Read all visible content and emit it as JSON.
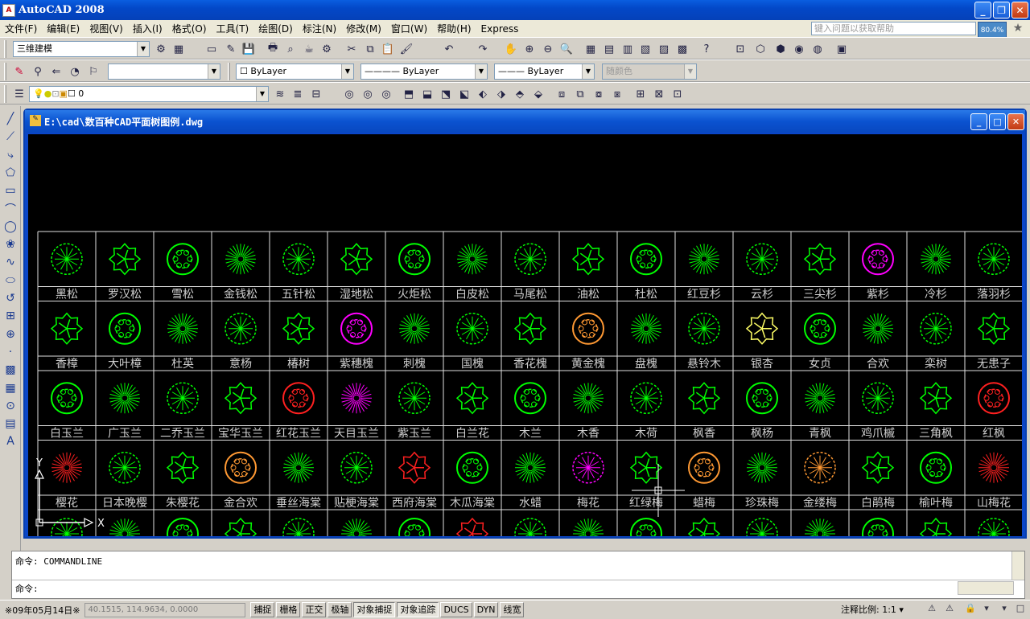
{
  "app": {
    "title": "AutoCAD 2008",
    "icon_text": "A"
  },
  "menu": [
    "文件(F)",
    "编辑(E)",
    "视图(V)",
    "插入(I)",
    "格式(O)",
    "工具(T)",
    "绘图(D)",
    "标注(N)",
    "修改(M)",
    "窗口(W)",
    "帮助(H)",
    "Express"
  ],
  "help_placeholder": "键入问题以获取帮助",
  "zoom_badge": "80.4%",
  "workspace": "三维建模",
  "layer_row": {
    "layer": "0"
  },
  "props": {
    "color": "ByLayer",
    "linetype": "ByLayer",
    "lineweight": "ByLayer",
    "plotstyle": "随颜色"
  },
  "document": {
    "title": "E:\\cad\\数百种CAD平面树图例.dwg"
  },
  "rows": [
    [
      "黑松",
      "罗汉松",
      "雪松",
      "金钱松",
      "五针松",
      "湿地松",
      "火炬松",
      "白皮松",
      "马尾松",
      "油松",
      "杜松",
      "红豆杉",
      "云杉",
      "三尖杉",
      "紫杉",
      "冷杉",
      "落羽杉"
    ],
    [
      "香樟",
      "大叶樟",
      "杜英",
      "意杨",
      "椿树",
      "紫穗槐",
      "刺槐",
      "国槐",
      "香花槐",
      "黄金槐",
      "盘槐",
      "悬铃木",
      "银杏",
      "女贞",
      "合欢",
      "栾树",
      "无患子"
    ],
    [
      "白玉兰",
      "广玉兰",
      "二乔玉兰",
      "宝华玉兰",
      "红花玉兰",
      "天目玉兰",
      "紫玉兰",
      "白兰花",
      "木兰",
      "木香",
      "木荷",
      "枫香",
      "枫杨",
      "青枫",
      "鸡爪槭",
      "三角枫",
      "红枫"
    ],
    [
      "樱花",
      "日本晚樱",
      "朱樱花",
      "金合欢",
      "垂丝海棠",
      "贴梗海棠",
      "西府海棠",
      "木瓜海棠",
      "水蜡",
      "梅花",
      "红绿梅",
      "蜡梅",
      "珍珠梅",
      "金缕梅",
      "白鹃梅",
      "榆叶梅",
      "山梅花"
    ]
  ],
  "symbol_colors": {
    "default": "#00ff00",
    "magenta": "#ff00ff",
    "orange": "#ff9933",
    "red": "#ff2020",
    "yellow": "#ffff66"
  },
  "ucs": {
    "x": "X",
    "y": "Y"
  },
  "cmd": {
    "history": "命令: COMMANDLINE",
    "prompt": "命令:"
  },
  "status": {
    "date": "※09年05月14日※",
    "coords": "40.1515, 114.9634, 0.0000",
    "buttons": [
      "捕捉",
      "栅格",
      "正交",
      "极轴",
      "对象捕捉",
      "对象追踪",
      "DUCS",
      "DYN",
      "线宽"
    ],
    "anno_label": "注释比例:",
    "anno_value": "1:1"
  }
}
